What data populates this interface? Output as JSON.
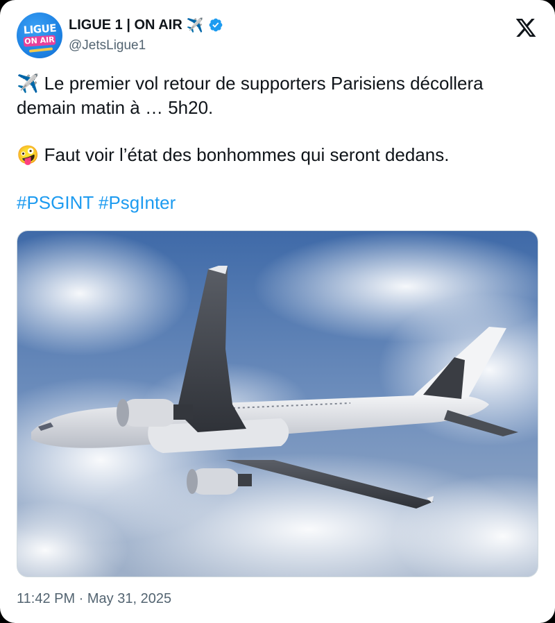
{
  "tweet": {
    "author": {
      "display_name": "LIGUE 1 | ON AIR",
      "name_emoji": "✈️",
      "handle": "@JetsLigue1",
      "avatar_text_top": "LIGUE 1",
      "avatar_text_bottom": "ON AIR",
      "verified": true
    },
    "text_line1_emoji": "✈️",
    "text_line1": " Le premier vol retour de supporters Parisiens décollera demain matin à … 5h20.",
    "text_line2_emoji": "🤪",
    "text_line2": " Faut voir l’état des bonhommes qui seront dedans.",
    "hashtags": "#PSGINT #PsgInter",
    "media": {
      "description_icon": "airplane-photo"
    },
    "timestamp": "11:42 PM · May 31, 2025"
  },
  "colors": {
    "text": "#0f1419",
    "secondary": "#536471",
    "link": "#1d9bf0",
    "verified": "#1d9bf0"
  }
}
